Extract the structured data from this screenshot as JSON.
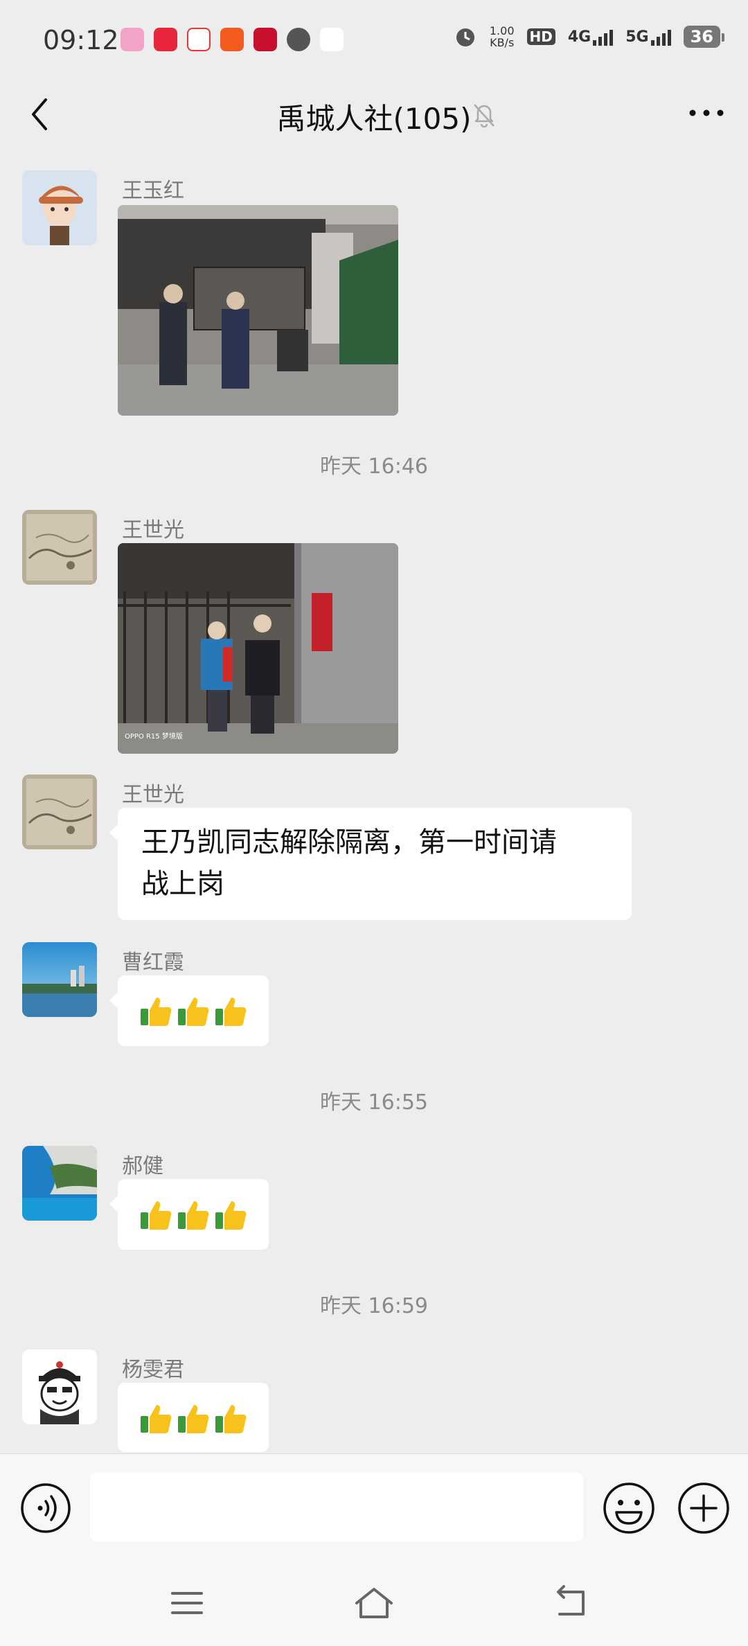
{
  "status_bar": {
    "time": "09:12",
    "net_speed_value": "1.00",
    "net_speed_unit": "KB/s",
    "hd_label": "HD",
    "lte_label": "4G",
    "nr_label": "5G",
    "battery": "36"
  },
  "header": {
    "title": "禹城人社(105)",
    "icons": [
      "back-icon",
      "mute-bell-icon",
      "more-icon"
    ]
  },
  "messages": [
    {
      "sender": "王玉红",
      "type": "image"
    },
    {
      "type": "time",
      "text": "昨天 16:46"
    },
    {
      "sender": "王世光",
      "type": "image",
      "watermark": "OPPO R15 梦境版"
    },
    {
      "sender": "王世光",
      "type": "text",
      "lines": [
        "王乃凯同志解除隔离，第一时间请",
        "战上岗"
      ]
    },
    {
      "sender": "曹红霞",
      "type": "emoji",
      "icon": "thumbs-up-icon",
      "count": 3
    },
    {
      "type": "time",
      "text": "昨天 16:55"
    },
    {
      "sender": "郝健",
      "type": "emoji",
      "icon": "thumbs-up-icon",
      "count": 3
    },
    {
      "type": "time",
      "text": "昨天 16:59"
    },
    {
      "sender": "杨雯君",
      "type": "emoji",
      "icon": "thumbs-up-icon",
      "count": 3
    }
  ],
  "input": {
    "value": "",
    "icons": [
      "voice-icon",
      "emoji-icon",
      "add-icon"
    ]
  },
  "nav": {
    "icons": [
      "menu-icon",
      "home-icon",
      "back-nav-icon"
    ]
  },
  "colors": {
    "background": "#ededed",
    "bubble": "#ffffff",
    "timestamp": "#8a8a8a",
    "sender": "#7a7a7a"
  }
}
